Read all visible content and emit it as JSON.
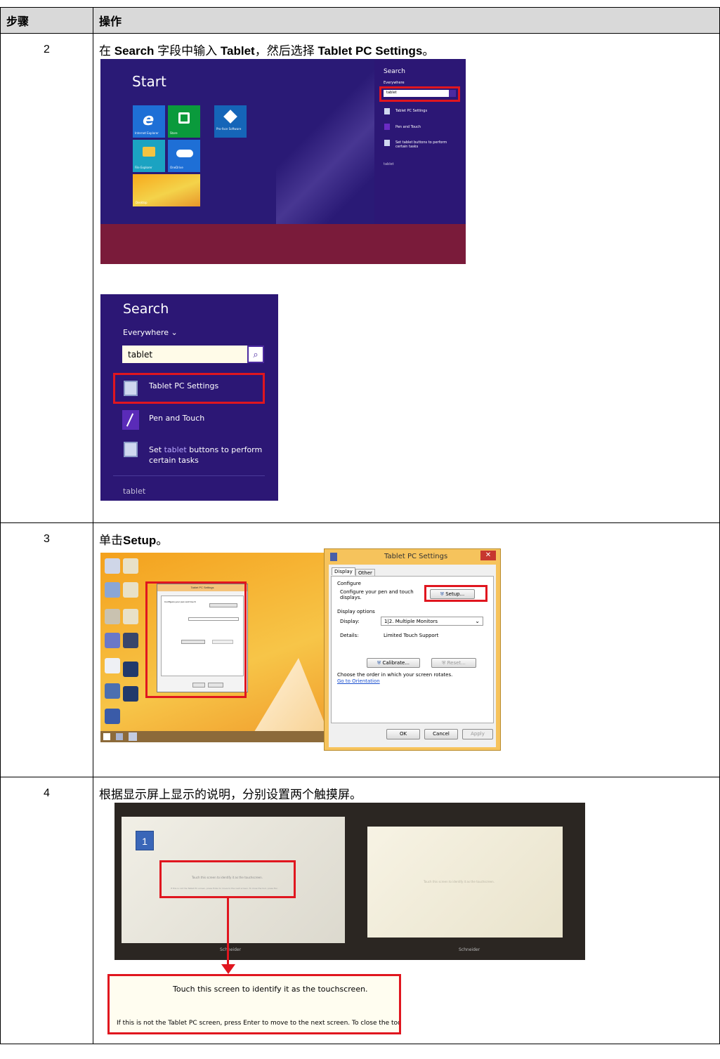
{
  "table": {
    "header": {
      "step": "步骤",
      "action": "操作"
    },
    "rows": [
      {
        "step": "2",
        "text_parts": [
          "在 ",
          "Search",
          " 字段中输入 ",
          "Tablet",
          "，然后选择 ",
          "Tablet PC Settings",
          "。"
        ],
        "start_screen": {
          "title": "Start",
          "tiles": [
            "Internet Explorer",
            "Store",
            "Pro-face Software",
            "File Explorer",
            "OneDrive",
            "Desktop"
          ],
          "search_panel": {
            "title": "Search",
            "scope": "Everywhere",
            "query": "tablet",
            "results": [
              "Tablet PC Settings",
              "Pen and Touch",
              "Set tablet buttons to perform certain tasks"
            ],
            "footer": "tablet"
          }
        },
        "search_zoom": {
          "title": "Search",
          "scope": "Everywhere",
          "query": "tablet",
          "result_1": "Tablet PC Settings",
          "result_2": "Pen and Touch",
          "result_3_pre": "Set ",
          "result_3_hl": "tablet",
          "result_3_post": " buttons to perform",
          "result_3_line2": "certain tasks",
          "footer": "tablet"
        }
      },
      {
        "step": "3",
        "text_pre": "单击",
        "text_bold": "Setup",
        "text_post": "。",
        "dialog": {
          "title": "Tablet PC Settings",
          "tab_display": "Display",
          "tab_other": "Other",
          "group_configure": "Configure",
          "configure_text_1": "Configure your pen and touch",
          "configure_text_2": "displays.",
          "setup_button": "Setup...",
          "group_display_options": "Display options",
          "display_label": "Display:",
          "display_value": "1|2. Multiple Monitors",
          "details_label": "Details:",
          "details_value": "Limited Touch Support",
          "calibrate_button": "Calibrate...",
          "reset_button": "Reset...",
          "orientation_text": "Choose the order in which your screen rotates.",
          "orientation_link": "Go to Orientation",
          "ok_button": "OK",
          "cancel_button": "Cancel",
          "apply_button": "Apply"
        }
      },
      {
        "step": "4",
        "text": "根据显示屏上显示的说明，分别设置两个触摸屏。",
        "monitor_badge": "1",
        "monitor_brand": "Schneider",
        "callout_line_1": "Touch this screen to identify it as the touchscreen.",
        "callout_line_2": "If this is not the Tablet PC screen, press Enter to move to the next screen. To close the tool, press Esc."
      }
    ]
  },
  "colors": {
    "win8_purple": "#2a1a76",
    "highlight_red": "#e0161f",
    "desktop_orange": "#f3a51f"
  }
}
